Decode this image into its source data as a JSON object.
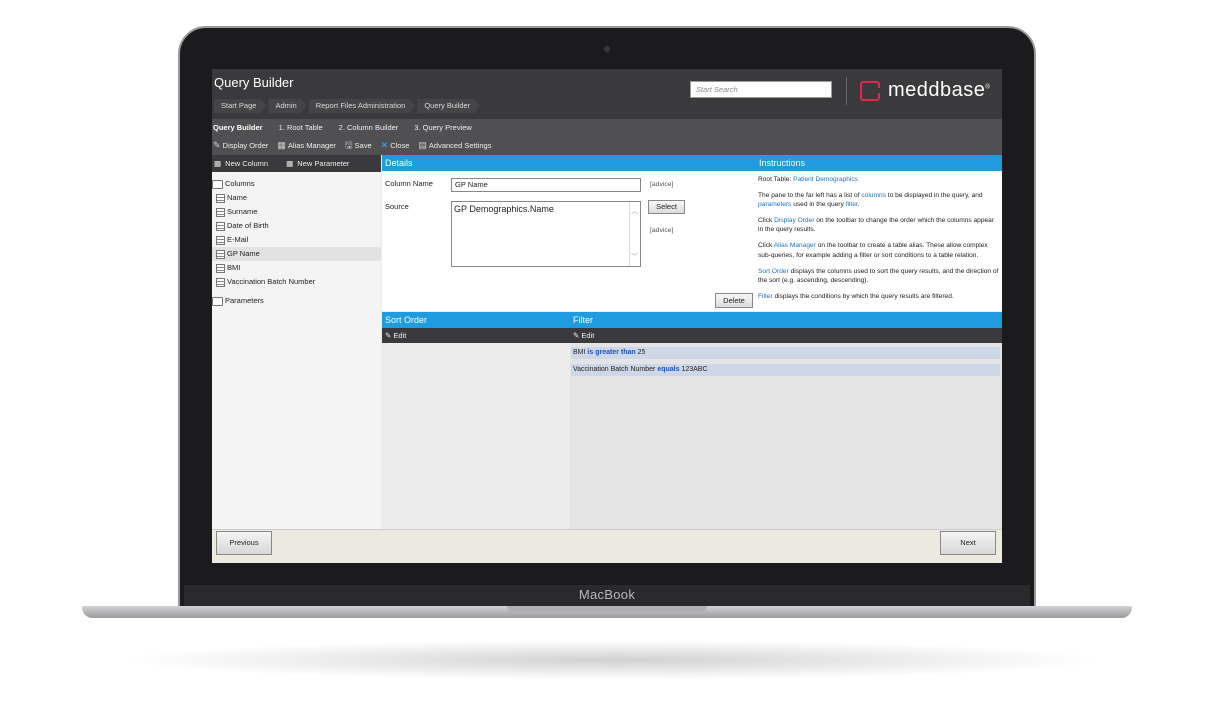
{
  "device": {
    "label": "MacBook"
  },
  "header": {
    "title": "Query Builder",
    "breadcrumbs": [
      "Start Page",
      "Admin",
      "Report Files Administration",
      "Query Builder"
    ],
    "search_placeholder": "Start Search",
    "logo_text": "meddbase",
    "logo_mark": "®"
  },
  "steps": {
    "current": "Query Builder",
    "items": [
      "1. Root Table",
      "2. Column Builder",
      "3. Query Preview"
    ]
  },
  "toolbar": {
    "display_order": "Display Order",
    "alias_manager": "Alias Manager",
    "save": "Save",
    "close": "Close",
    "advanced_settings": "Advanced Settings"
  },
  "left": {
    "new_column": "New Column",
    "new_parameter": "New Parameter",
    "columns_label": "Columns",
    "columns": [
      "Name",
      "Surname",
      "Date of Birth",
      "E-Mail",
      "GP Name",
      "BMI",
      "Vaccination Batch Number"
    ],
    "selected": "GP Name",
    "parameters_label": "Parameters"
  },
  "details": {
    "heading": "Details",
    "column_name_label": "Column Name",
    "column_name_value": "GP Name",
    "source_label": "Source",
    "source_value": "GP Demographics.Name",
    "advice": "[advice]",
    "select_button": "Select",
    "delete_button": "Delete"
  },
  "instructions": {
    "heading": "Instructions",
    "root_table_prefix": "Root Table: ",
    "root_table": "Patient Demographics",
    "p1a": "The pane to the far left has a list of ",
    "p1_columns": "columns",
    "p1b": " to be displayed in the query, and ",
    "p1_parameters": "parameters",
    "p1c": " used in the query ",
    "p1_filter": "filter",
    "p1d": ".",
    "p2a": "Click ",
    "p2_link": "Display Order",
    "p2b": " on the toolbar to change the order which the columns appear in the query results.",
    "p3a": "Click ",
    "p3_link": "Alias Manager",
    "p3b": " on the toolbar to create a table alias. These allow complex sub-queries, for example adding a filter or sort conditions to a table relation.",
    "p4_link": "Sort Order",
    "p4b": " displays the columns used to sort the query results, and the direction of the sort (e.g. ascending, descending).",
    "p5_link": "Filter",
    "p5b": " displays the conditions by which the query results are filtered."
  },
  "sort_order": {
    "heading": "Sort Order",
    "edit": "Edit"
  },
  "filter": {
    "heading": "Filter",
    "edit": "Edit",
    "rows": [
      {
        "field": "BMI",
        "op": "is greater than",
        "value": "25"
      },
      {
        "field": "Vaccination Batch Number",
        "op": "equals",
        "value": "123ABC"
      }
    ]
  },
  "footer": {
    "previous": "Previous",
    "next": "Next"
  },
  "colors": {
    "accent": "#1f9be0",
    "brand": "#e2264d",
    "header": "#3a3a3c"
  }
}
